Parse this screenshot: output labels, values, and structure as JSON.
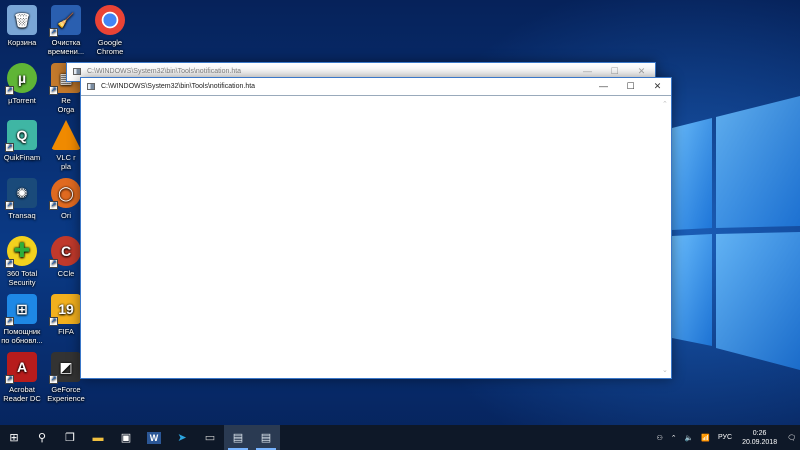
{
  "desktop": {
    "icons": [
      {
        "name": "recycle-bin",
        "label": "Корзина",
        "color": "#7aa6d6"
      },
      {
        "name": "cleanup",
        "label": "Очистка\nвремени...",
        "color": "#2a5fb0"
      },
      {
        "name": "chrome",
        "label": "Google\nChrome",
        "color": "#e0e0e0"
      },
      {
        "name": "utorrent",
        "label": "µTorrent",
        "color": "#5fb536"
      },
      {
        "name": "re-orga",
        "label": "Re\nOrga",
        "color": "#c47a2c"
      },
      {
        "name": "quikfinam",
        "label": "QuikFinam",
        "color": "#3fb6a4"
      },
      {
        "name": "vlc",
        "label": "VLC r\npla",
        "color": "#f08a00"
      },
      {
        "name": "transaq",
        "label": "Transaq",
        "color": "#1a4a7a"
      },
      {
        "name": "ori",
        "label": "Ori",
        "color": "#e06a20"
      },
      {
        "name": "360-security",
        "label": "360 Total\nSecurity",
        "color": "#2fae3a"
      },
      {
        "name": "ccleaner",
        "label": "CCle",
        "color": "#c0392b"
      },
      {
        "name": "helper",
        "label": "Помощник\nпо обновл...",
        "color": "#1e88e5"
      },
      {
        "name": "fifa",
        "label": "FIFA",
        "color": "#f2b01e"
      },
      {
        "name": "acrobat",
        "label": "Acrobat\nReader DC",
        "color": "#b71c1c"
      },
      {
        "name": "geforce",
        "label": "GeForce\nExperience",
        "color": "#333333"
      }
    ]
  },
  "windows": {
    "back": {
      "title": "C:\\WINDOWS\\System32\\bin\\Tools\\notification.hta"
    },
    "front": {
      "title": "C:\\WINDOWS\\System32\\bin\\Tools\\notification.hta"
    },
    "controls": {
      "minimize": "—",
      "maximize": "☐",
      "close": "✕"
    }
  },
  "taskbar": {
    "start": "⊞",
    "search": "⚲",
    "taskview": "❐",
    "pinned": [
      {
        "name": "explorer",
        "glyph": "▬",
        "color": "#f0c040"
      },
      {
        "name": "store",
        "glyph": "▣",
        "color": "#ffffff"
      },
      {
        "name": "word",
        "glyph": "W",
        "color": "#2b5797"
      },
      {
        "name": "telegram",
        "glyph": "➤",
        "color": "#2ca5e0"
      },
      {
        "name": "app",
        "glyph": "▭",
        "color": "#cfcfcf"
      },
      {
        "name": "hta-1",
        "glyph": "▤",
        "color": "#dfe8f0"
      },
      {
        "name": "hta-2",
        "glyph": "▤",
        "color": "#dfe8f0"
      }
    ],
    "tray": {
      "people": "⚇",
      "chevron": "⌃",
      "volume": "🔈",
      "network": "📶",
      "lang": "РУС",
      "time": "0:26",
      "date": "20.09.2018",
      "notifications": "🗨"
    }
  }
}
